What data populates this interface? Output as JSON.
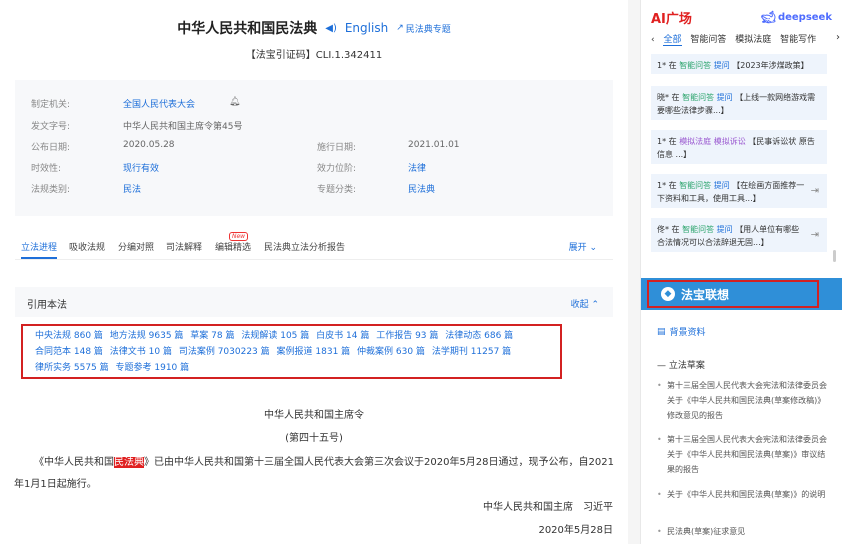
{
  "doc": {
    "title": "中华人民共和国民法典",
    "lang_link": "English",
    "topic_link": "民法典专题",
    "cite_code": "【法宝引证码】CLI.1.342411"
  },
  "meta": {
    "rows": [
      {
        "label": "制定机关:",
        "value": "全国人民代表大会"
      },
      {
        "label": "发文字号:",
        "value": "中华人民共和国主席令第45号"
      },
      {
        "label": "公布日期:",
        "value": "2020.05.28",
        "label2": "施行日期:",
        "value2": "2021.01.01"
      },
      {
        "label": "时效性:",
        "value": "现行有效",
        "label2": "效力位阶:",
        "value2": "法律"
      },
      {
        "label": "法规类别:",
        "value": "民法",
        "label2": "专题分类:",
        "value2": "民法典"
      }
    ]
  },
  "tabs": {
    "items": [
      "立法进程",
      "吸收法规",
      "分编对照",
      "司法解释",
      "编辑精选",
      "民法典立法分析报告"
    ],
    "new_badge": "New",
    "expand": "展开"
  },
  "cite": {
    "title": "引用本法",
    "collapse": "收起",
    "lines": [
      [
        "中央法规 860 篇",
        "地方法规 9635 篇",
        "草案 78 篇",
        "法规解读 105 篇",
        "白皮书 14 篇",
        "工作报告 93 篇",
        "法律动态 686 篇"
      ],
      [
        "合同范本 148 篇",
        "法律文书 10 篇",
        "司法案例 7030223 篇",
        "案例报道 1831 篇",
        "仲裁案例 630 篇",
        "法学期刊 11257 篇"
      ],
      [
        "律所实务 5575 篇",
        "专题参考 1910 篇"
      ]
    ]
  },
  "body": {
    "heading": "中华人民共和国主席令",
    "number": "(第四十五号)",
    "para_prefix": "《中华人民共和国",
    "para_highlight": "民法典",
    "para_suffix": "》已由中华人民共和国第十三届全国人民代表大会第三次会议于2020年5月28日通过，现予公布，自2021年1月1日起施行。",
    "signer": "中华人民共和国主席　习近平",
    "date": "2020年5月28日"
  },
  "sidebar": {
    "ai_title": "AI广场",
    "ds_logo": "deepseek",
    "tabs": [
      "全部",
      "智能问答",
      "模拟法庭",
      "智能写作"
    ],
    "cards": [
      {
        "user": "1* 在 ",
        "mod": "智能问答",
        "act": " 提问 ",
        "text": "【2023年涉煤政策】",
        "mod_color": "g"
      },
      {
        "user": "晓* 在 ",
        "mod": "智能问答",
        "act": " 提问 ",
        "text": "【上线一款网络游戏需要哪些法律步骤...】",
        "mod_color": "g"
      },
      {
        "user": "1* 在 ",
        "mod": "模拟法庭",
        "act": " 模拟诉讼 ",
        "text": "【民事诉讼状 原告信息 ...】",
        "mod_color": "p"
      },
      {
        "user": "1* 在 ",
        "mod": "智能问答",
        "act": " 提问 ",
        "text": "【在绘画方面推荐一下资料和工具，使用工具...】",
        "mod_color": "g"
      },
      {
        "user": "佟* 在 ",
        "mod": "智能问答",
        "act": " 提问 ",
        "text": "【用人单位有哪些合法情况可以合法辞退无固...】",
        "mod_color": "g"
      }
    ],
    "assoc_label": "法宝联想",
    "bg_title": "背景资料",
    "bg_sub": "立法草案",
    "bg_items": [
      "第十三届全国人民代表大会宪法和法律委员会关于《中华人民共和国民法典(草案修改稿)》修改意见的报告",
      "第十三届全国人民代表大会宪法和法律委员会关于《中华人民共和国民法典(草案)》审议结果的报告",
      "关于《中华人民共和国民法典(草案)》的说明",
      "民法典(草案)征求意见"
    ]
  }
}
